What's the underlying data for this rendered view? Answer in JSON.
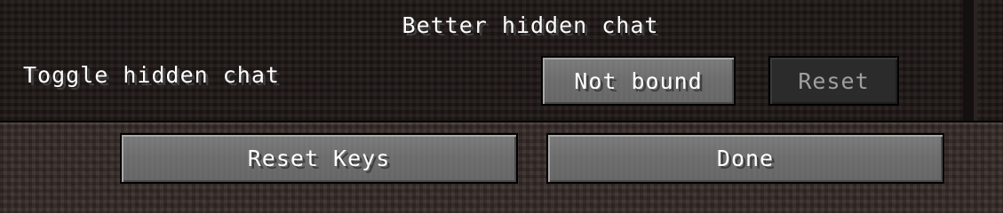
{
  "screen": {
    "category_title": "Better hidden chat"
  },
  "keybinds": [
    {
      "label": "Toggle hidden chat",
      "binding": "Not bound",
      "reset_label": "Reset"
    }
  ],
  "footer": {
    "reset_keys_label": "Reset Keys",
    "done_label": "Done"
  }
}
